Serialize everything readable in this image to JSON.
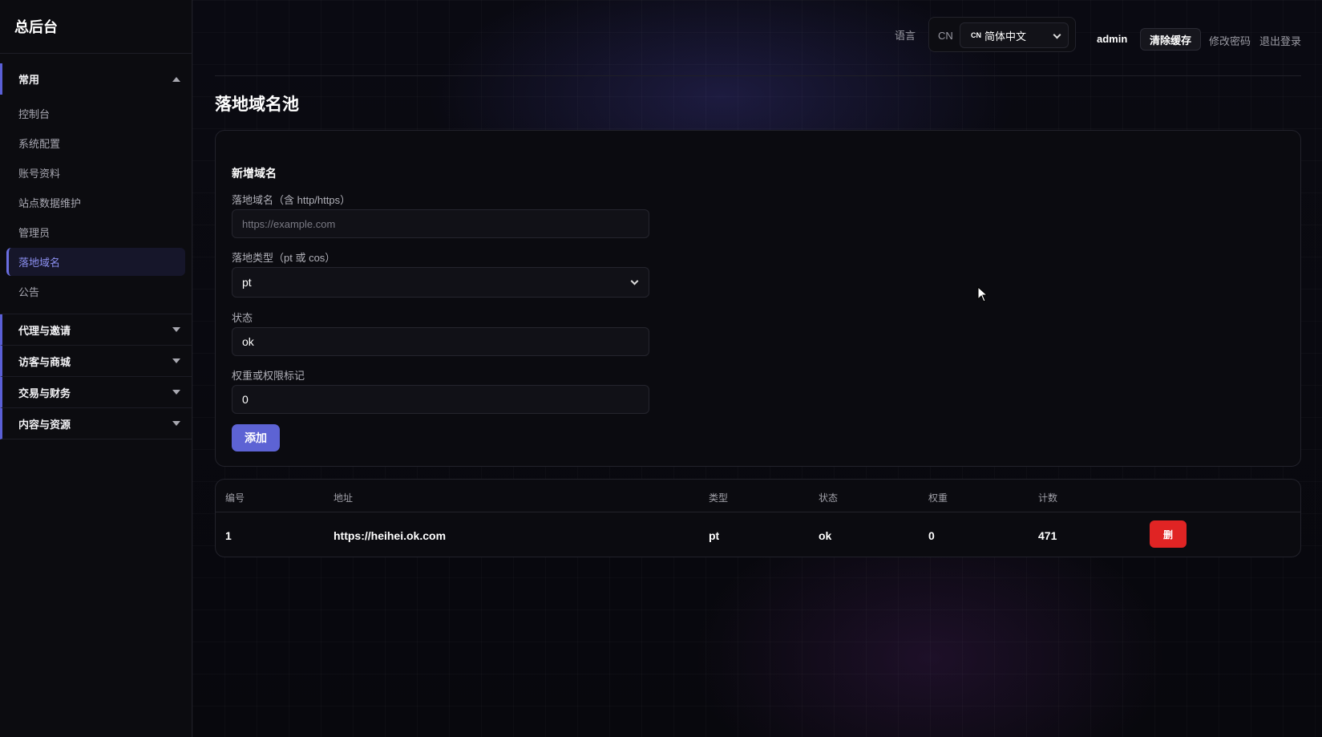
{
  "brand": "总后台",
  "sidebar": {
    "groups": [
      {
        "label": "常用",
        "expanded": true
      },
      {
        "label": "代理与邀请",
        "expanded": false
      },
      {
        "label": "访客与商城",
        "expanded": false
      },
      {
        "label": "交易与财务",
        "expanded": false
      },
      {
        "label": "内容与资源",
        "expanded": false
      }
    ],
    "items": [
      {
        "label": "控制台"
      },
      {
        "label": "系统配置"
      },
      {
        "label": "账号资料"
      },
      {
        "label": "站点数据维护"
      },
      {
        "label": "管理员"
      },
      {
        "label": "落地域名",
        "active": true
      },
      {
        "label": "公告"
      }
    ]
  },
  "header": {
    "lang_label": "语言",
    "lang_prefix": "CN",
    "lang_select_flag": "CN",
    "lang_select_value": "简体中文",
    "user": "admin",
    "clear_cache": "清除缓存",
    "change_password": "修改密码",
    "logout": "退出登录"
  },
  "page": {
    "title": "落地域名池"
  },
  "form": {
    "title": "新增域名",
    "domain_label": "落地域名（含 http/https）",
    "domain_placeholder": "https://example.com",
    "type_label": "落地类型（pt 或 cos）",
    "type_value": "pt",
    "status_label": "状态",
    "status_value": "ok",
    "weight_label": "权重或权限标记",
    "weight_value": "0",
    "add_button": "添加"
  },
  "table": {
    "columns": [
      "编号",
      "地址",
      "类型",
      "状态",
      "权重",
      "计数"
    ],
    "rows": [
      {
        "id": "1",
        "address": "https://heihei.ok.com",
        "type": "pt",
        "status": "ok",
        "weight": "0",
        "count": "471",
        "action": "删"
      }
    ]
  },
  "colors": {
    "accent": "#5d63d4",
    "danger": "#e02424",
    "active_item": "#8b8ff0"
  }
}
